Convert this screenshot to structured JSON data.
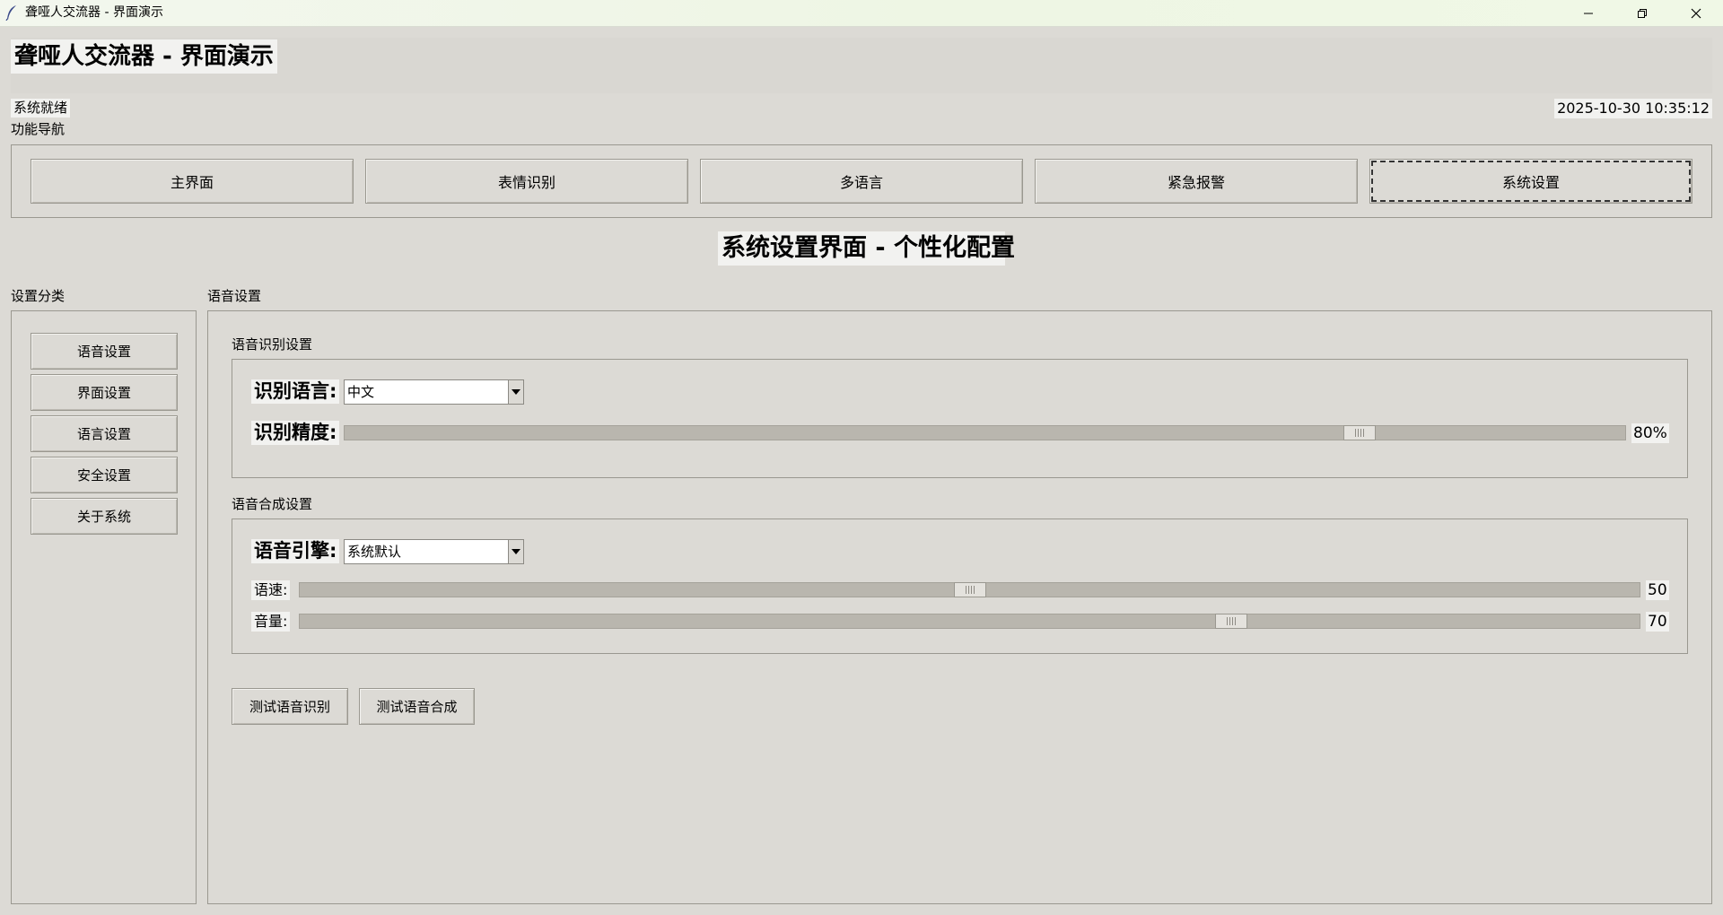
{
  "window": {
    "title": "聋哑人交流器 - 界面演示"
  },
  "header": {
    "app_title": "聋哑人交流器 - 界面演示",
    "status": "系统就绪",
    "datetime": "2025-10-30 10:35:12",
    "nav_label": "功能导航"
  },
  "nav": {
    "tabs": [
      {
        "label": "主界面"
      },
      {
        "label": "表情识别"
      },
      {
        "label": "多语言"
      },
      {
        "label": "紧急报警"
      },
      {
        "label": "系统设置"
      }
    ],
    "active_index": 4
  },
  "page": {
    "title": "系统设置界面 - 个性化配置"
  },
  "sidebar": {
    "label": "设置分类",
    "items": [
      {
        "label": "语音设置"
      },
      {
        "label": "界面设置"
      },
      {
        "label": "语言设置"
      },
      {
        "label": "安全设置"
      },
      {
        "label": "关于系统"
      }
    ]
  },
  "main": {
    "label": "语音设置",
    "recognition": {
      "group_label": "语音识别设置",
      "language_label": "识别语言:",
      "language_value": "中文",
      "accuracy_label": "识别精度:",
      "accuracy_value": 80,
      "accuracy_text": "80%"
    },
    "synthesis": {
      "group_label": "语音合成设置",
      "engine_label": "语音引擎:",
      "engine_value": "系统默认",
      "speed_label": "语速:",
      "speed_value": 50,
      "speed_text": "50",
      "volume_label": "音量:",
      "volume_value": 70,
      "volume_text": "70"
    },
    "buttons": {
      "test_recognition": "测试语音识别",
      "test_synthesis": "测试语音合成"
    }
  }
}
